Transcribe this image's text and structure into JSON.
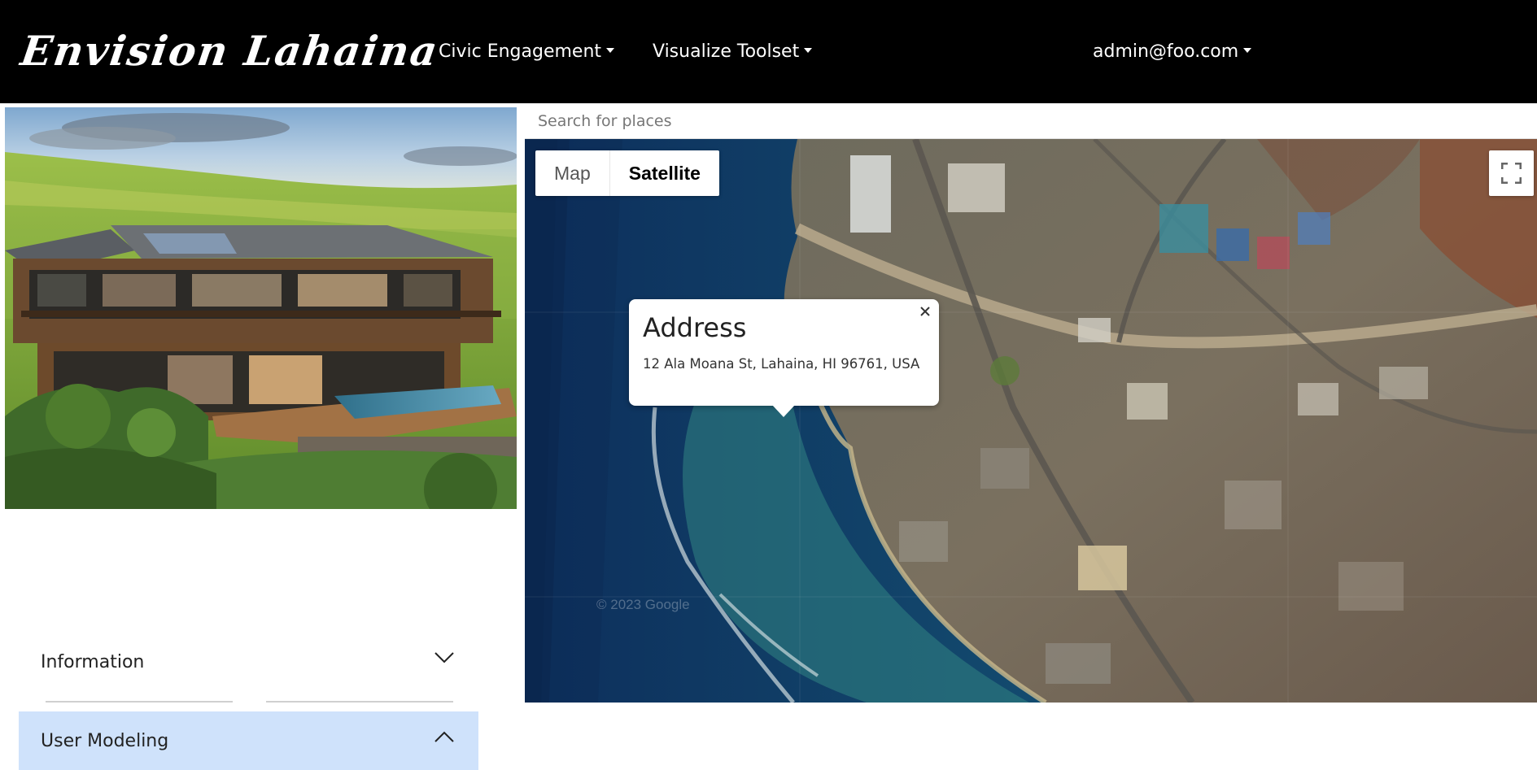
{
  "navbar": {
    "brand": "Envision Lahaina",
    "menus": [
      {
        "label": "Civic Engagement"
      },
      {
        "label": "Visualize Toolset"
      }
    ],
    "user": "admin@foo.com"
  },
  "sidebar": {
    "hero_image": "modern-house-photo",
    "accordion": [
      {
        "label": "Information",
        "expanded": false
      },
      {
        "label": "User Modeling",
        "expanded": true
      }
    ],
    "colors": {
      "active_section": "#cfe2fb"
    }
  },
  "map": {
    "search_placeholder": "Search for places",
    "map_type": {
      "map_label": "Map",
      "satellite_label": "Satellite",
      "selected": "Satellite"
    },
    "fullscreen_icon": "fullscreen-icon",
    "info_window": {
      "title": "Address",
      "text": "12 Ala Moana St, Lahaina, HI 96761, USA"
    },
    "watermark": "© 2023 Google"
  }
}
